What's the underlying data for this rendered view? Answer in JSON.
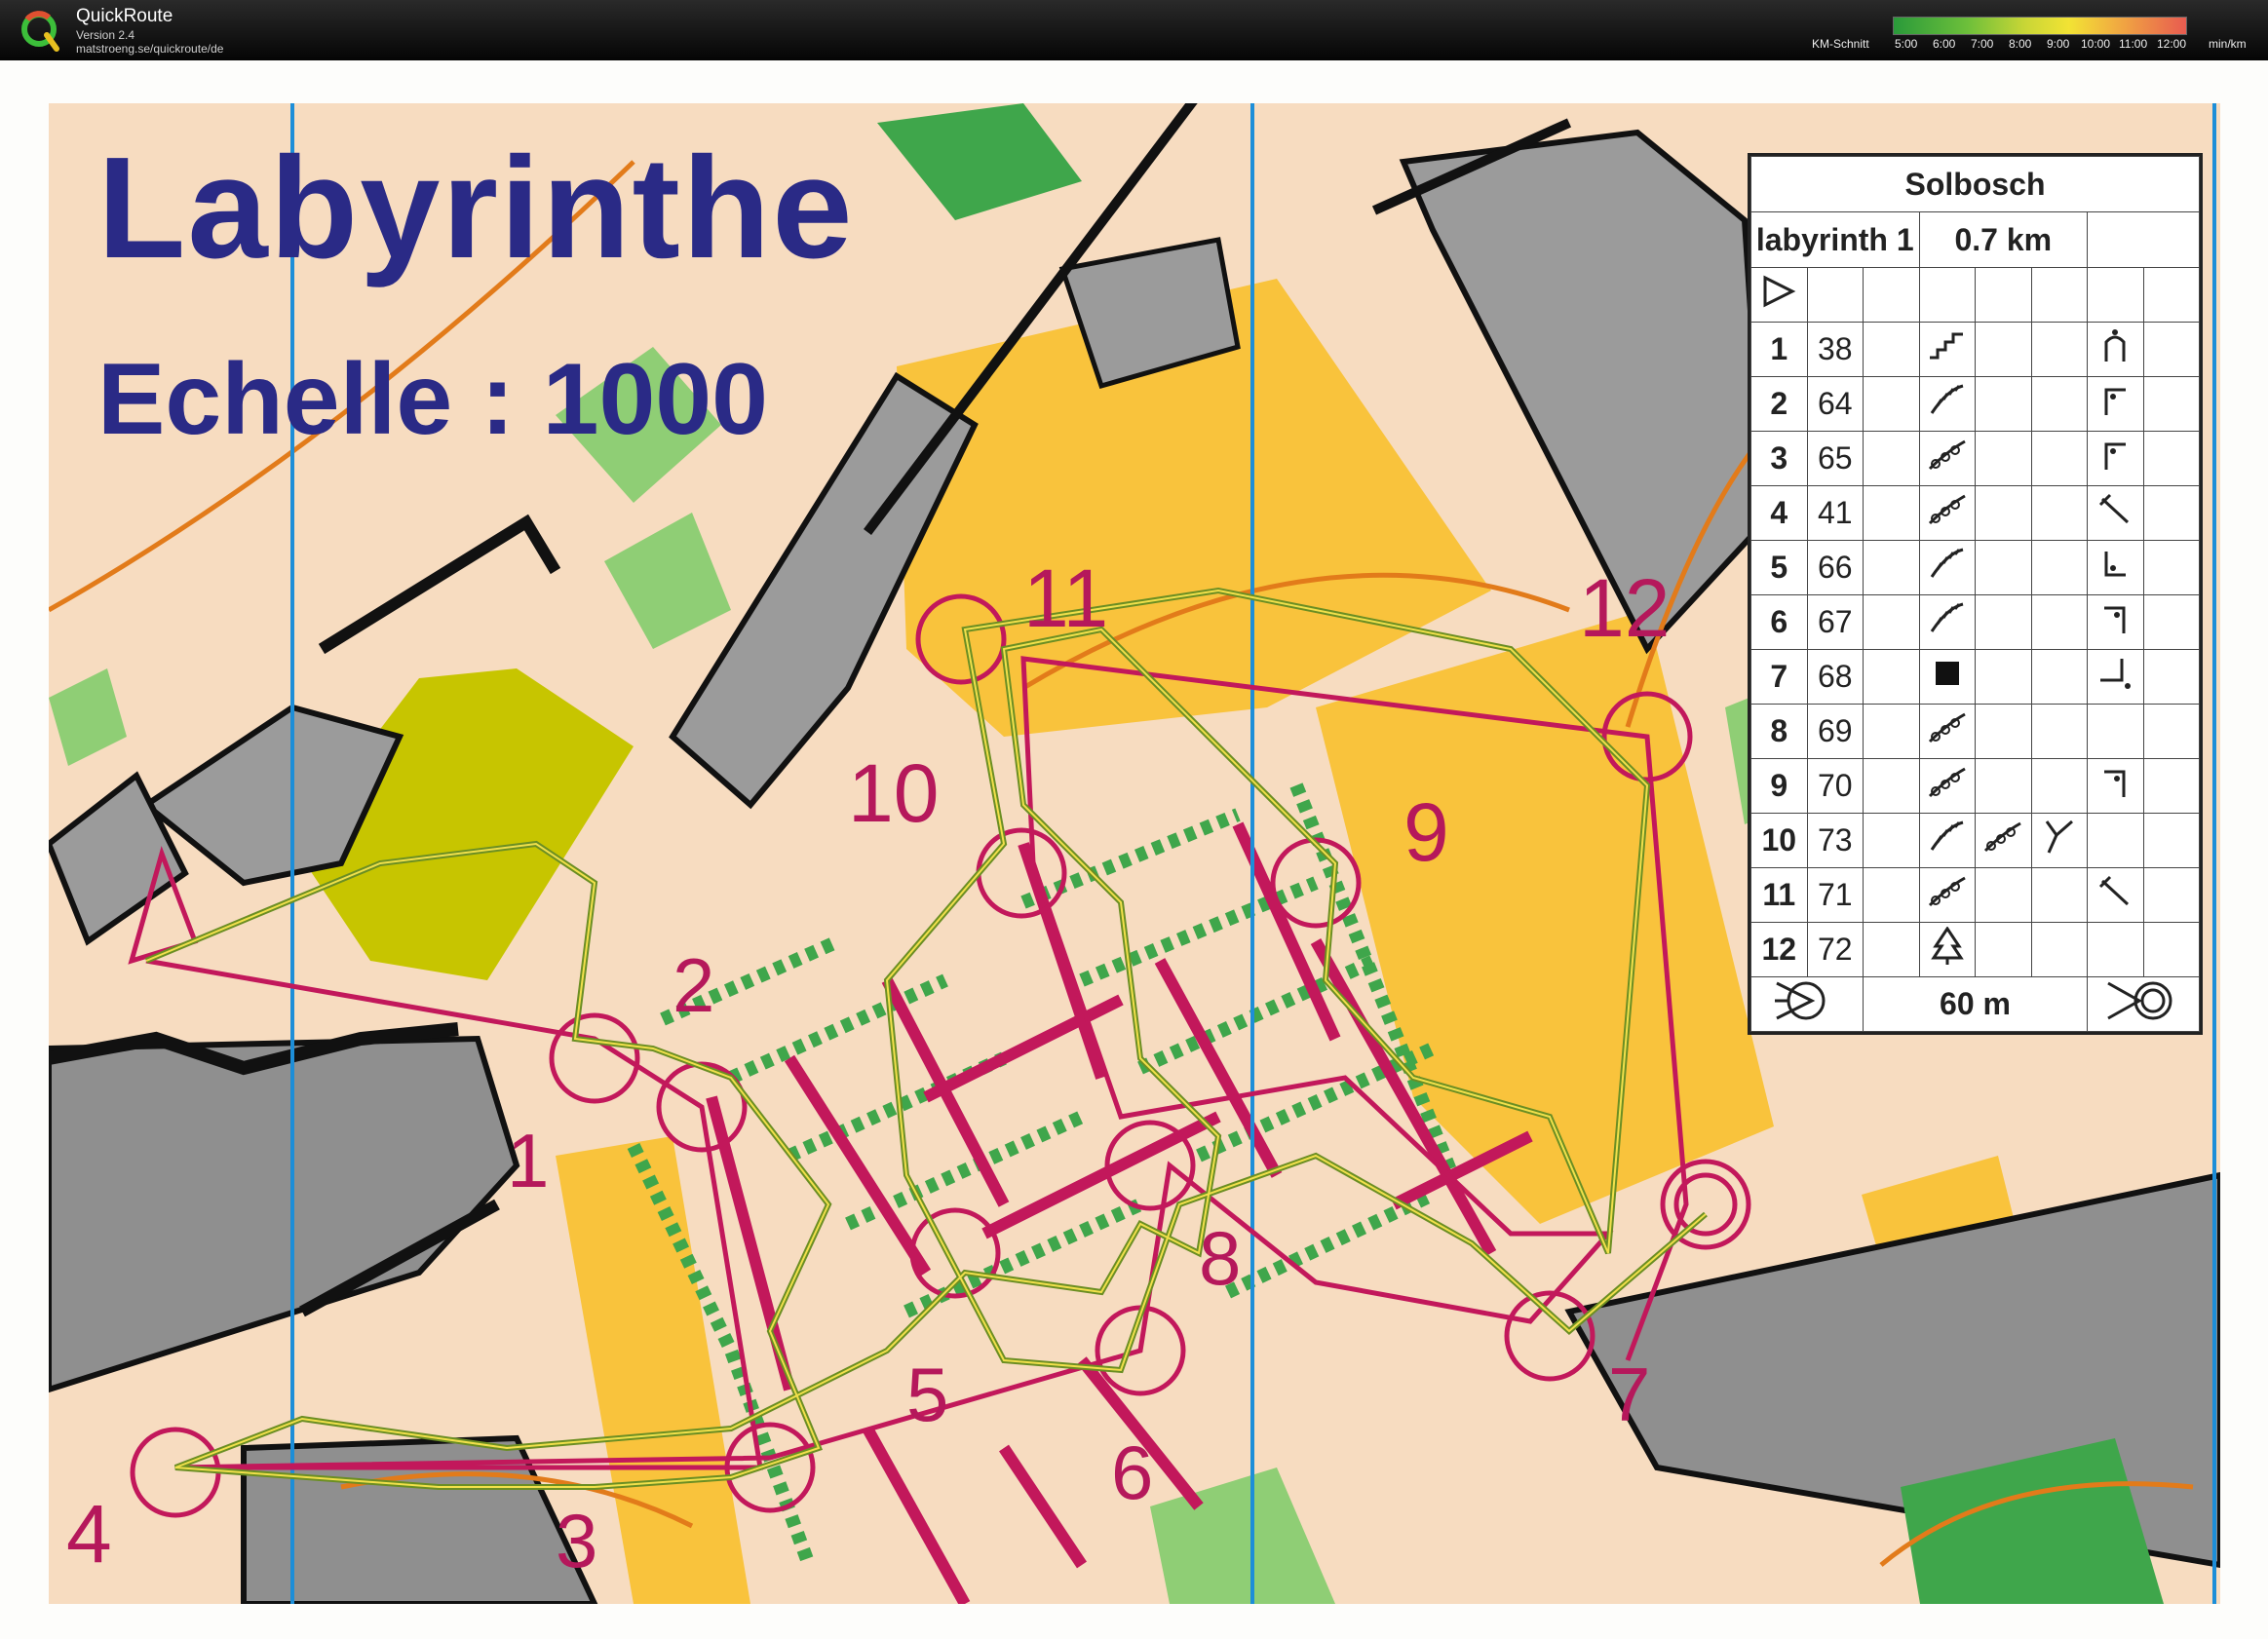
{
  "app": {
    "name": "QuickRoute",
    "version": "Version 2.4",
    "url": "matstroeng.se/quickroute/de",
    "legend_label": "KM-Schnitt",
    "pace_ticks": [
      "5:00",
      "6:00",
      "7:00",
      "8:00",
      "9:00",
      "10:00",
      "11:00",
      "12:00"
    ],
    "pace_unit": "min/km"
  },
  "map": {
    "title": "Labyrinthe",
    "subtitle": "Echelle : 1000",
    "control_labels": [
      "1",
      "2",
      "3",
      "4",
      "5",
      "6",
      "7",
      "8",
      "9",
      "10",
      "11",
      "12"
    ],
    "colors": {
      "course": "#c2185b",
      "route_outer": "#6b8e23",
      "route_inner": "#f1e04b",
      "title": "#2a2a86",
      "meridian": "#1d8ed8"
    }
  },
  "description": {
    "event": "Solbosch",
    "class": "labyrinth 1",
    "length": "0.7 km",
    "rows": [
      {
        "n": "1",
        "code": "38",
        "feature": "steps",
        "position": "gate"
      },
      {
        "n": "2",
        "code": "64",
        "feature": "wall",
        "position": "corner-inside"
      },
      {
        "n": "3",
        "code": "65",
        "feature": "fence",
        "position": "corner-inside"
      },
      {
        "n": "4",
        "code": "41",
        "feature": "fence",
        "position": "end"
      },
      {
        "n": "5",
        "code": "66",
        "feature": "wall",
        "position": "corner-se"
      },
      {
        "n": "6",
        "code": "67",
        "feature": "wall",
        "position": "corner-ne"
      },
      {
        "n": "7",
        "code": "68",
        "feature": "square",
        "position": "corner-se2"
      },
      {
        "n": "8",
        "code": "69",
        "feature": "fence",
        "position": ""
      },
      {
        "n": "9",
        "code": "70",
        "feature": "fence",
        "position": "corner-ne"
      },
      {
        "n": "10",
        "code": "73",
        "feature": "wall",
        "feature2": "fence",
        "feature3": "junction",
        "position": ""
      },
      {
        "n": "11",
        "code": "71",
        "feature": "fence",
        "position": "end"
      },
      {
        "n": "12",
        "code": "72",
        "feature": "tree",
        "position": ""
      }
    ],
    "finish_distance": "60 m"
  }
}
